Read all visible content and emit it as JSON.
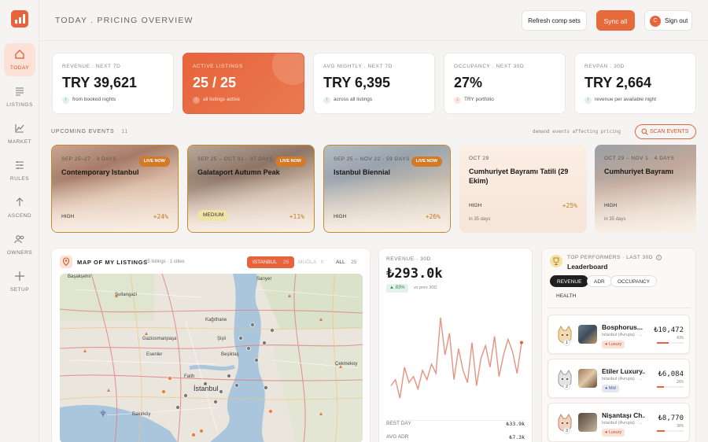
{
  "nav": [
    {
      "label": "TODAY",
      "active": true
    },
    {
      "label": "LISTINGS"
    },
    {
      "label": "MARKET"
    },
    {
      "label": "RULES"
    },
    {
      "label": "ASCEND"
    },
    {
      "label": "OWNERS"
    },
    {
      "label": "SETUP"
    }
  ],
  "header": {
    "title": "TODAY . PRICING OVERVIEW",
    "refresh_label": "Refresh comp sets",
    "sync_label": "Sync all",
    "avatar_initial": "C",
    "signout_label": "Sign out"
  },
  "kpis": [
    {
      "label": "REVENUE . NEXT 7D",
      "value": "TRY 39,621",
      "sub": "from booked nights",
      "trend": "up"
    },
    {
      "label": "ACTIVE LISTINGS",
      "value": "25 / 25",
      "sub": "all listings active",
      "trend": "up"
    },
    {
      "label": "AVG NIGHTLY . NEXT 7D",
      "value": "TRY 6,395",
      "sub": "across all listings",
      "trend": "up"
    },
    {
      "label": "OCCUPANCY . NEXT 30D",
      "value": "27%",
      "sub": "TRY portfolio",
      "trend": "down"
    },
    {
      "label": "REVPAN . 30D",
      "value": "TRY 2,664",
      "sub": "revenue per available night",
      "trend": "up"
    }
  ],
  "events": {
    "title": "UPCOMING EVENTS",
    "count": "11",
    "note": "demand events affecting pricing",
    "scan_label": "SCAN EVENTS",
    "items": [
      {
        "date": "SEP 25–27 · 3 DAYS",
        "name": "Contemporary Istanbul",
        "live": "LIVE NOW",
        "impact": "HIGH",
        "pct": "+24%"
      },
      {
        "date": "SEP 25 – OCT 31 · 37 DAYS",
        "name": "Galataport Autumn Peak",
        "live": "LIVE NOW",
        "impact": "MEDIUM",
        "pct": "+11%"
      },
      {
        "date": "SEP 25 – NOV 22 · 59 DAYS",
        "name": "Istanbul Biennial",
        "live": "LIVE NOW",
        "impact": "HIGH",
        "pct": "+26%"
      },
      {
        "date": "OCT 29",
        "name": "Cumhuriyet Bayramı Tatili (29 Ekim)",
        "impact": "HIGH",
        "pct": "+25%",
        "days": "in 35 days"
      },
      {
        "date": "OCT 29 – NOV 1 · 4 DAYS",
        "name": "Cumhuriyet Bayramı",
        "impact": "HIGH",
        "days": "in 35 days"
      }
    ]
  },
  "map": {
    "title": "MAP OF MY LISTINGS",
    "subtitle": "25 listings · 1 cities",
    "tabs": [
      {
        "label": "ISTANBUL",
        "count": "25",
        "active": true
      },
      {
        "label": "MUĞLA",
        "count": "0"
      },
      {
        "label": "ALL",
        "count": "25"
      }
    ],
    "places": [
      "Başakşehir",
      "Sultangazi",
      "Sarıyer",
      "Kağıthane",
      "Gaziosmanpaşa",
      "Şişli",
      "Esenler",
      "Beşiktaş",
      "Çekmekoy",
      "Fatih",
      "İstanbul",
      "Bakırköy"
    ]
  },
  "revenue": {
    "title": "REVENUE · 30D",
    "value": "₺293.0k",
    "change": "▲ 83%",
    "change_sub": "vs prev 30D",
    "best_label": "BEST DAY",
    "best_value": "₺33.9k",
    "adr_label": "AVG ADR",
    "adr_value": "₺7.3k"
  },
  "chart_data": {
    "type": "line",
    "title": "",
    "values": [
      8,
      10,
      4,
      14,
      9,
      11,
      7,
      13,
      10,
      15,
      12,
      30,
      18,
      25,
      10,
      20,
      13,
      9,
      22,
      8,
      17,
      21,
      14,
      24,
      11,
      18,
      23,
      19,
      12,
      22
    ]
  },
  "leaderboard": {
    "section": "TOP PERFORMERS · LAST 30D",
    "title": "Leaderboard",
    "chips": [
      {
        "label": "REVENUE",
        "active": true
      },
      {
        "label": "ADR"
      },
      {
        "label": "OCCUPANCY"
      },
      {
        "label": "HEALTH"
      }
    ],
    "rows": [
      {
        "rank": "1",
        "name": "Bosphorus...",
        "loc": "İstanbul (Avrupa) · ...",
        "tag": "Luxury",
        "value": "₺10,472",
        "sub": "43%",
        "share": 0.43
      },
      {
        "rank": "2",
        "name": "Etiler Luxury...",
        "loc": "İstanbul (Avrupa) · ...",
        "tag": "Mid",
        "value": "₺6,084",
        "sub": "26%",
        "share": 0.26
      },
      {
        "rank": "3",
        "name": "Nişantaşı Ch...",
        "loc": "İstanbul (Avrupa) · ...",
        "tag": "Luxury",
        "value": "₺8,770",
        "sub": "30%",
        "share": 0.3
      }
    ]
  },
  "colors": {
    "accent": "#e8633c",
    "gold": "#c58a2a",
    "green": "#2c8c5a",
    "red": "#d24a30"
  }
}
